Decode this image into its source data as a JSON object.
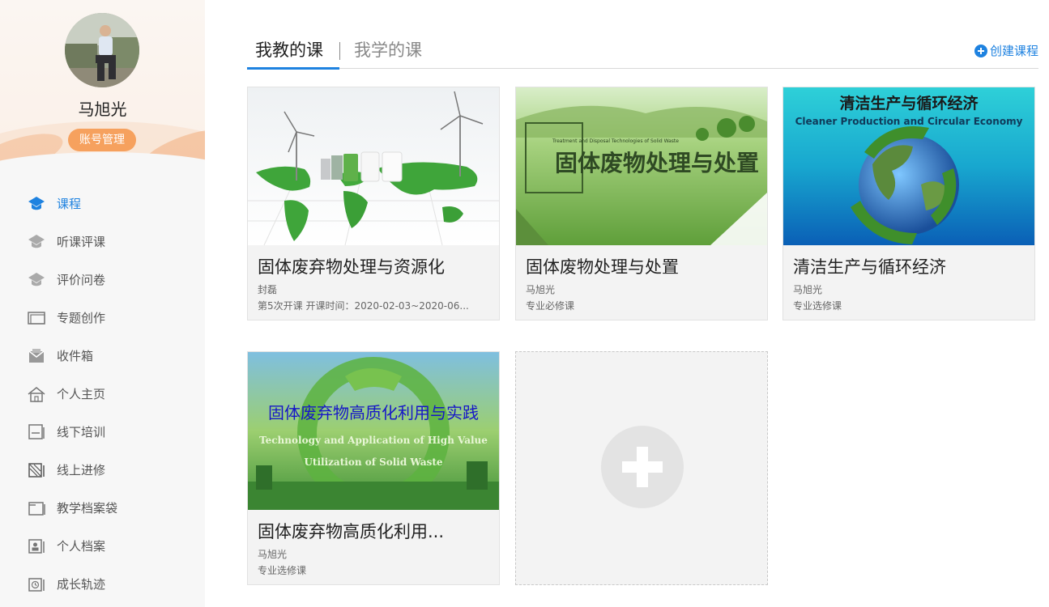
{
  "profile": {
    "name": "马旭光",
    "account_button": "账号管理"
  },
  "nav": [
    {
      "label": "课程",
      "icon": "graduation-cap-icon",
      "active": true
    },
    {
      "label": "听课评课",
      "icon": "graduation-cap-icon"
    },
    {
      "label": "评价问卷",
      "icon": "graduation-cap-icon"
    },
    {
      "label": "专题创作",
      "icon": "topic-icon"
    },
    {
      "label": "收件箱",
      "icon": "inbox-icon"
    },
    {
      "label": "个人主页",
      "icon": "home-icon"
    },
    {
      "label": "线下培训",
      "icon": "offline-training-icon"
    },
    {
      "label": "线上进修",
      "icon": "online-study-icon"
    },
    {
      "label": "教学档案袋",
      "icon": "folder-icon"
    },
    {
      "label": "个人档案",
      "icon": "personal-file-icon"
    },
    {
      "label": "成长轨迹",
      "icon": "growth-icon"
    }
  ],
  "tabs": {
    "teach": "我教的课",
    "learn": "我学的课",
    "active": "teach"
  },
  "create_course": "创建课程",
  "courses": [
    {
      "title": "固体废弃物处理与资源化",
      "meta1": "封磊",
      "meta2": "第5次开课   开课时间：2020-02-03~2020-06..."
    },
    {
      "title": "固体废物处理与处置",
      "meta1": "马旭光",
      "meta2": "专业必修课",
      "cover_text_small": "Treatment and Disposal Technologies of Solid Waste",
      "cover_text_big": "固体废物处理与处置"
    },
    {
      "title": "清洁生产与循环经济",
      "meta1": "马旭光",
      "meta2": "专业选修课",
      "cover_text_big": "清洁生产与循环经济",
      "cover_text_small": "Cleaner Production and Circular Economy"
    },
    {
      "title": "固体废弃物高质化利用...",
      "meta1": "马旭光",
      "meta2": "专业选修课",
      "cover_text_big": "固体废弃物高质化利用与实践",
      "cover_text_en1": "Technology and Application of High Value",
      "cover_text_en2": "Utilization of Solid Waste"
    }
  ],
  "colors": {
    "accent": "#1e82e0",
    "account_button": "#f6a15e"
  }
}
